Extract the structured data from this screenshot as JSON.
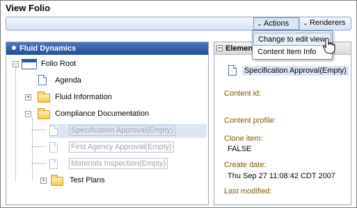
{
  "page": {
    "title": "View Folio"
  },
  "toolbar": {
    "actions_label": "Actions",
    "renderers_label": "Renderers",
    "chevron": "⌄"
  },
  "menu": {
    "items": [
      {
        "label": "Change to edit view"
      },
      {
        "label": "Content Item Info"
      }
    ]
  },
  "tree": {
    "header": "Fluid Dynamics",
    "rows": [
      {
        "label": "Folio Root",
        "icon": "folio-root-icon",
        "expander": "−"
      },
      {
        "label": "Agenda",
        "icon": "document-icon"
      },
      {
        "label": "Fluid Information",
        "icon": "folder-icon",
        "expander": "+"
      },
      {
        "label": "Compliance Documentation",
        "icon": "folder-open-icon",
        "expander": "−"
      },
      {
        "label": "Specification Approval(Empty)",
        "icon": "document-icon",
        "state": "placeholder-selected"
      },
      {
        "label": "First Agency Approval(Empty)",
        "icon": "document-icon",
        "state": "placeholder"
      },
      {
        "label": "Materials Inspection(Empty)",
        "icon": "document-icon",
        "state": "placeholder"
      },
      {
        "label": "Test Plans",
        "icon": "folder-icon",
        "expander": "+"
      }
    ]
  },
  "element_panel": {
    "header": "Element",
    "collapse_symbol": "−",
    "item_title": "Specification Approval(Empty)",
    "fields": [
      {
        "label": "Content id:",
        "value": ""
      },
      {
        "label": "Content profile:",
        "value": ""
      },
      {
        "label": "Clone item:",
        "value": "FALSE"
      },
      {
        "label": "Create date:",
        "value": "Thu Sep 27 11:08:42 CDT 2007"
      },
      {
        "label": "Last modified:",
        "value": ""
      }
    ]
  },
  "colors": {
    "tree_header": "#1e4d9b",
    "field_label": "#7a5a00",
    "selection": "#dde7f4"
  }
}
